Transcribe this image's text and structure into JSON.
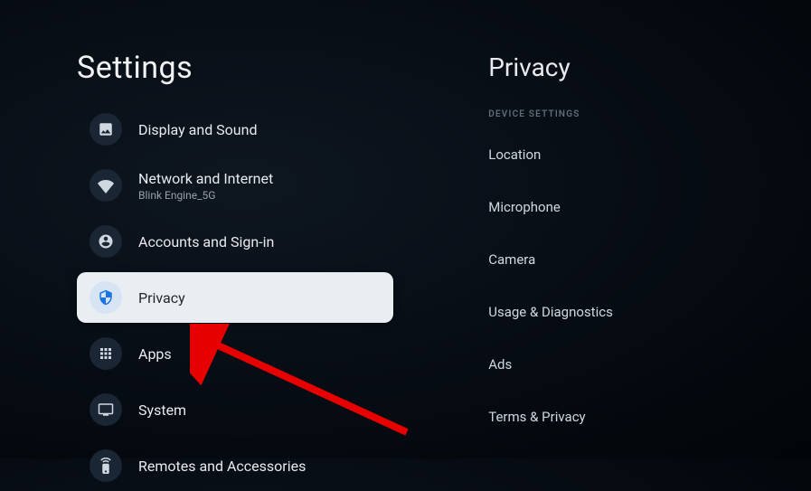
{
  "left": {
    "title": "Settings",
    "items": [
      {
        "label": "Display and Sound",
        "sublabel": ""
      },
      {
        "label": "Network and Internet",
        "sublabel": "Blink Engine_5G"
      },
      {
        "label": "Accounts and Sign-in",
        "sublabel": ""
      },
      {
        "label": "Privacy",
        "sublabel": ""
      },
      {
        "label": "Apps",
        "sublabel": ""
      },
      {
        "label": "System",
        "sublabel": ""
      },
      {
        "label": "Remotes and Accessories",
        "sublabel": ""
      }
    ]
  },
  "right": {
    "title": "Privacy",
    "section_header": "DEVICE SETTINGS",
    "items": [
      {
        "label": "Location"
      },
      {
        "label": "Microphone"
      },
      {
        "label": "Camera"
      },
      {
        "label": "Usage & Diagnostics"
      },
      {
        "label": "Ads"
      },
      {
        "label": "Terms & Privacy"
      }
    ]
  }
}
